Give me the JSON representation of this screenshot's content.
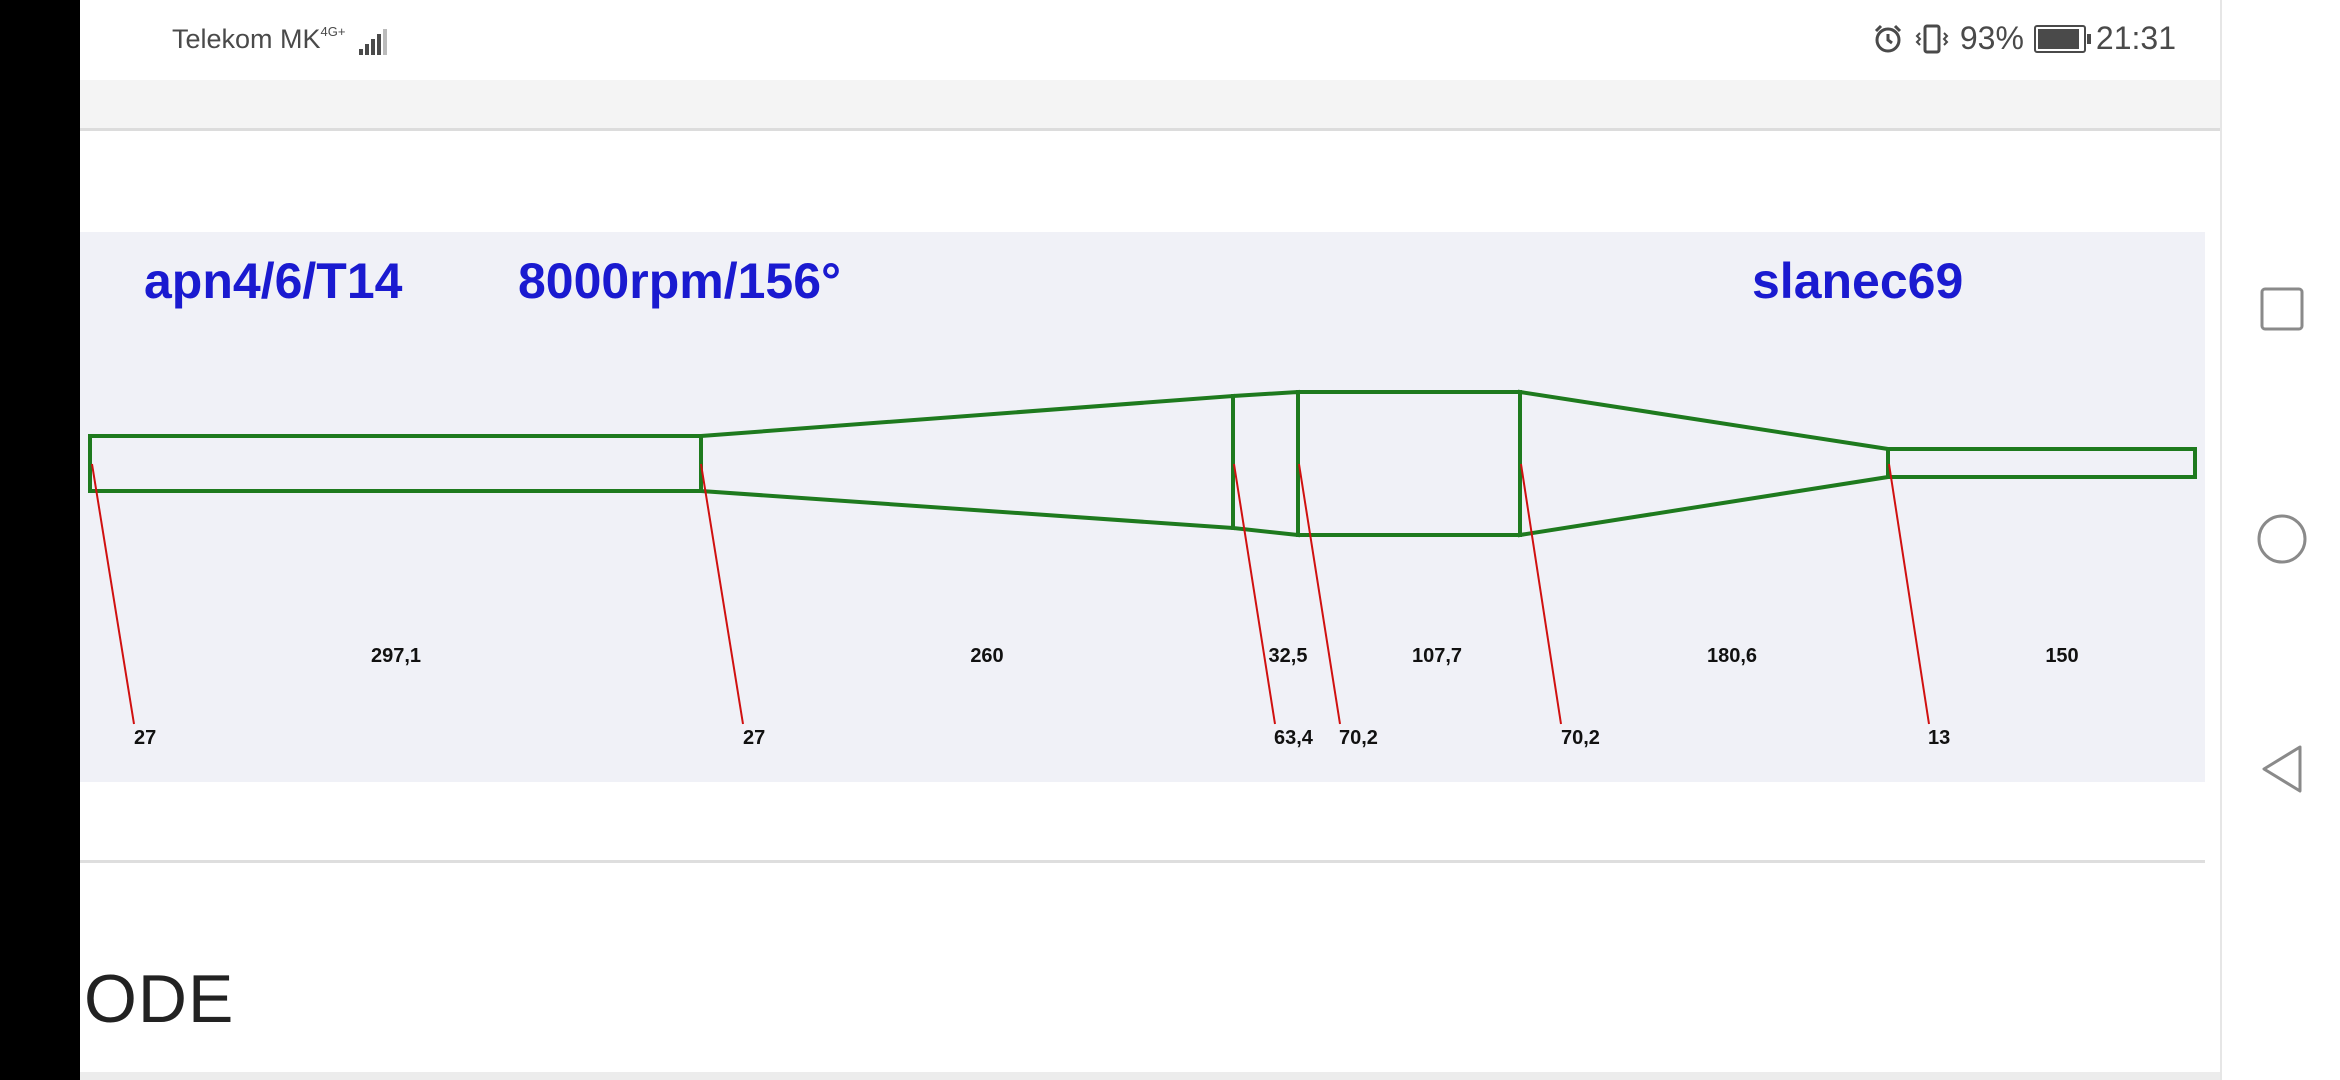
{
  "status_bar": {
    "carrier": "Telekom MK",
    "network": "4G+",
    "battery": "93%",
    "battery_level": 0.93,
    "time": "21:31"
  },
  "diagram": {
    "model": "apn4/6/T14",
    "spec": "8000rpm/156°",
    "author": "slanec69",
    "lengths": [
      {
        "label": "297,1"
      },
      {
        "label": "260"
      },
      {
        "label": "32,5"
      },
      {
        "label": "107,7"
      },
      {
        "label": "180,6"
      },
      {
        "label": "150"
      }
    ],
    "diameters": [
      {
        "label": "27"
      },
      {
        "label": "27"
      },
      {
        "label": "63,4"
      },
      {
        "label": "70,2"
      },
      {
        "label": "70,2"
      },
      {
        "label": "13"
      }
    ],
    "colors": {
      "outline": "#1e7a1e",
      "leader": "#d01010",
      "title": "#1a1ad0"
    }
  },
  "content": {
    "heading": "ODE"
  },
  "nav": {
    "icons": [
      "recent-apps-icon",
      "home-icon",
      "back-icon"
    ]
  }
}
